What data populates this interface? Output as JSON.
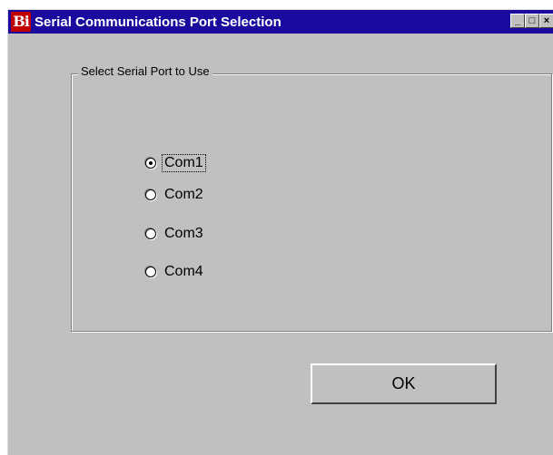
{
  "window": {
    "title": "Serial Communications Port Selection",
    "icon_text": "Bi"
  },
  "group": {
    "label": "Select Serial Port to Use"
  },
  "ports": [
    {
      "label": "Com1",
      "selected": true
    },
    {
      "label": "Com2",
      "selected": false
    },
    {
      "label": "Com3",
      "selected": false
    },
    {
      "label": "Com4",
      "selected": false
    }
  ],
  "ok_button": {
    "label": "OK"
  }
}
